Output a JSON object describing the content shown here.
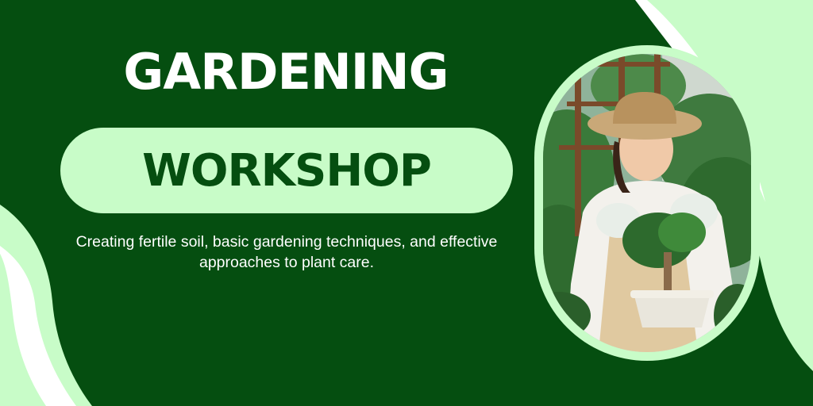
{
  "banner": {
    "title_line1": "GARDENING",
    "title_line2": "WORKSHOP",
    "subtitle": "Creating fertile soil, basic gardening techniques, and effective approaches to plant care.",
    "photo_icon": "woman-gardening-bonsai-photo"
  },
  "colors": {
    "background": "#054e10",
    "accent": "#c8fcc8",
    "title_text": "#ffffff",
    "pill_text": "#054e10"
  }
}
